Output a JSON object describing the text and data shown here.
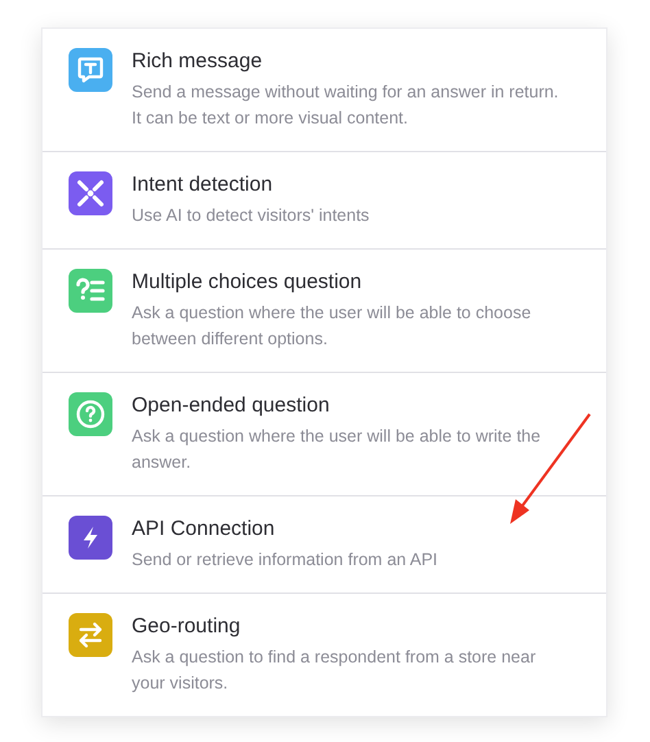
{
  "items": [
    {
      "kind": "message",
      "color": "#4aaff0",
      "title": "Rich message",
      "description": "Send a message without waiting for an answer in return. It can be text or more visual content."
    },
    {
      "kind": "intent",
      "color": "#7b5cf0",
      "title": "Intent detection",
      "description": "Use AI to detect visitors' intents"
    },
    {
      "kind": "choices",
      "color": "#4ccf7f",
      "title": "Multiple choices question",
      "description": "Ask a question where the user will be able to choose between different options."
    },
    {
      "kind": "question",
      "color": "#4ccf7f",
      "title": "Open-ended question",
      "description": "Ask a question where the user will be able to write the answer."
    },
    {
      "kind": "api",
      "color": "#6a4fd4",
      "title": "API Connection",
      "description": "Send or retrieve information from an API"
    },
    {
      "kind": "swap",
      "color": "#d9ad10",
      "title": "Geo-routing",
      "description": "Ask a question to find a respondent from a store near your visitors."
    }
  ]
}
